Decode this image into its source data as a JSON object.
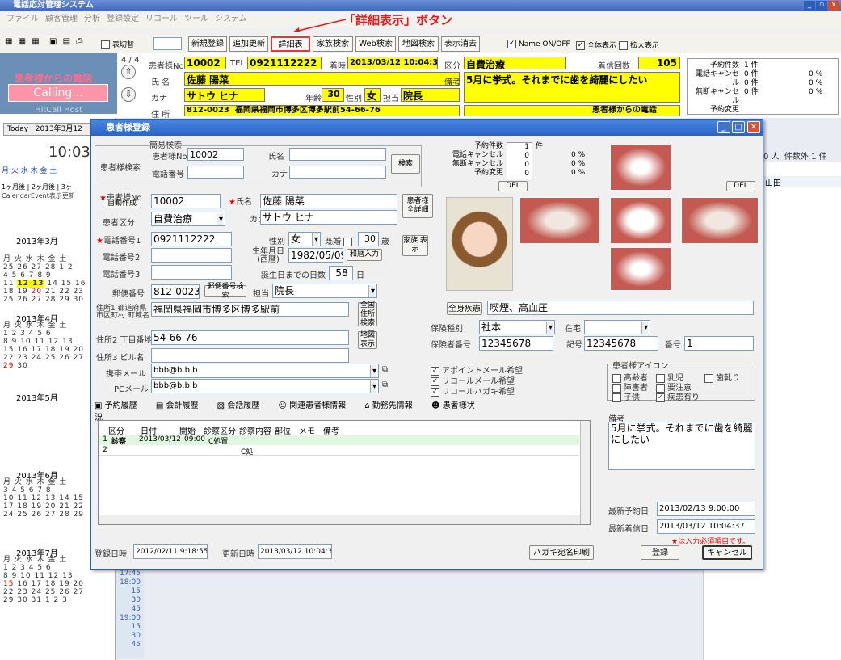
{
  "app": {
    "title": "電話応対管理システム",
    "menu": [
      "ファイル",
      "顧客管理",
      "分析",
      "登録設定",
      "リコール",
      "ツール",
      "システム"
    ]
  },
  "annotation": "「詳細表示」ボタン",
  "toolbar": {
    "switch_label": "表切替",
    "new": "新規登録",
    "update": "追加更新",
    "detail": "詳細表示",
    "family": "家族検索",
    "web": "Web検索",
    "map": "地図検索",
    "clear": "表示消去",
    "name_onoff": "Name ON/OFF",
    "all": "全体表示",
    "zoom": "拡大表示"
  },
  "info": {
    "page": "4 / 4",
    "patient_no_label": "患者様No",
    "patient_no": "10002",
    "tel_label": "TEL",
    "tel": "0921112222",
    "received_label": "着時",
    "received": "2013/03/12 10:04:37",
    "kubun_label": "区分",
    "kubun": "自費治療",
    "count_label": "着信回数",
    "count": "105",
    "name_label": "氏 名",
    "name": "佐藤 陽菜",
    "note_label": "備考",
    "note": "5月に挙式。それまでに歯を綺麗にしたい",
    "kana_label": "カナ",
    "kana": "サトウ ヒナ",
    "age_label": "年齢",
    "age": "30",
    "sex_label": "性別",
    "sex": "女",
    "tanto_label": "担当",
    "tanto": "院長",
    "addr_label": "住 所",
    "zip": "812-0023",
    "address": "福岡県福岡市博多区博多駅前54-66-76",
    "callfrom": "患者様からの電話",
    "stats": [
      "予約件数",
      "電話キャンセル",
      "無断キャンセル",
      "予約変更"
    ],
    "stat_vals": [
      "1 件",
      "0 件",
      "0 件",
      "0 件"
    ],
    "pcts": [
      "0 %",
      "0 %",
      "0 %"
    ]
  },
  "left": {
    "calling_title": "患者様からの電話",
    "calling_btn": "Calling...",
    "host": "HitCall Host",
    "today": "Today : 2013年3月12",
    "time": "10:03",
    "weekdays": "月 火 水 木 金 土",
    "range_btns": "1ヶ月後 | 2ヶ月後 | 3ヶ",
    "calendar_event": "CalendarEvent表示更新",
    "months": [
      "2013年3月",
      "2013年4月",
      "2013年5月",
      "2013年6月",
      "2013年7月"
    ]
  },
  "right_info": {
    "count": "0 人",
    "outside": "件数外 1 件",
    "name": "山田"
  },
  "times": [
    "17:45",
    "18:00",
    "15",
    "30",
    "45",
    "19:00",
    "15",
    "30",
    "45"
  ],
  "dialog": {
    "title": "患者様登録",
    "quick_search": "簡易検索",
    "search_label": "患者様検索",
    "no_label": "患者様No",
    "no_value": "10002",
    "name_label": "氏名",
    "tel_label": "電話番号",
    "kana_label": "カナ",
    "search_btn": "検索",
    "f_no_label": "患者様No",
    "auto_btn": "自動作成",
    "f_no": "10002",
    "f_name_label": "氏名",
    "f_name": "佐藤 陽菜",
    "detail_btn": "患者様 全詳細",
    "f_kana_label": "カナ",
    "f_kana": "サトウ ヒナ",
    "f_kubun_label": "患者区分",
    "f_kubun": "自費治療",
    "tel1_label": "電話番号1",
    "tel1": "0921112222",
    "tel2_label": "電話番号2",
    "tel3_label": "電話番号3",
    "sex_label": "性別",
    "sex": "女",
    "married_label": "既婚",
    "age": "30",
    "age_unit": "歳",
    "family_btn": "家族 表示",
    "birth_label": "生年月日 (西暦)",
    "birth": "1982/05/09",
    "wareki_btn": "和暦入力",
    "days_label": "誕生日までの日数",
    "days": "58",
    "days_unit": "日",
    "zip_label": "郵便番号",
    "zip": "812-0023",
    "zip_btn": "郵便番号検索",
    "tanto_label": "担当",
    "tanto": "院長",
    "addr1_label": "住所1 都道府県 市区町村 町域名",
    "addr1": "福岡県福岡市博多区博多駅前",
    "addr_btn": "全国 住所 検索",
    "addr2_label": "住所2 丁目番地",
    "addr2": "54-66-76",
    "map_btn": "地図 表示",
    "addr3_label": "住所3 ビル名",
    "mobile_label": "携帯メール",
    "mobile": "bbb@b.b.b",
    "pc_label": "PCメール",
    "pc": "bbb@b.b.b",
    "stats": [
      "予約件数",
      "電話キャンセル",
      "無断キャンセル",
      "予約変更"
    ],
    "stat_vals": [
      "1",
      "0",
      "0",
      "0"
    ],
    "stat_unit": "件",
    "pcts": [
      "0 %",
      "0 %",
      "0 %"
    ],
    "del": "DEL",
    "disease_btn": "全身疾患",
    "disease": "喫煙、高血圧",
    "ins_type_label": "保険種別",
    "ins_type": "社本",
    "home_label": "在宅",
    "ins_no_label": "保険者番号",
    "ins_no": "12345678",
    "kigo_label": "記号",
    "kigo": "12345678",
    "bango_label": "番号",
    "bango": "1",
    "appoint_mail": "アポイントメール希望",
    "recall_mail": "リコールメール希望",
    "recall_post": "リコールハガキ希望",
    "icon_title": "患者様アイコン",
    "icons": [
      "高齢者",
      "乳児",
      "歯軋り",
      "障害者",
      "要注意",
      "子供",
      "疾患有り"
    ],
    "tabs": [
      "予約履歴",
      "会計履歴",
      "会話履歴",
      "関連患者様情報",
      "勤務先情報",
      "患者様状況"
    ],
    "table_headers": [
      "区分",
      "日付",
      "開始",
      "診察区分",
      "診察内容",
      "部位",
      "メモ",
      "備考"
    ],
    "rows": [
      [
        "1",
        "診察",
        "2013/03/12",
        "09:00",
        "C処置",
        "",
        "",
        "",
        ""
      ],
      [
        "2",
        "",
        "",
        "",
        "",
        "C処",
        "",
        "",
        ""
      ]
    ],
    "memo_label": "備考",
    "memo": "5月に挙式。それまでに歯を綺麗にしたい",
    "last_appt_label": "最新予約日",
    "last_appt": "2013/02/13 9:00:00",
    "last_recv_label": "最新着信日",
    "last_recv": "2013/03/12 10:04:37",
    "required_note": "★は入力必須項目です。",
    "reg_label": "登録日時",
    "reg": "2012/02/11 9:18:55",
    "upd_label": "更新日時",
    "upd": "2013/03/12 10:04:37",
    "postcard_btn": "ハガキ宛名印刷",
    "save_btn": "登録",
    "cancel_btn": "キャンセル"
  }
}
